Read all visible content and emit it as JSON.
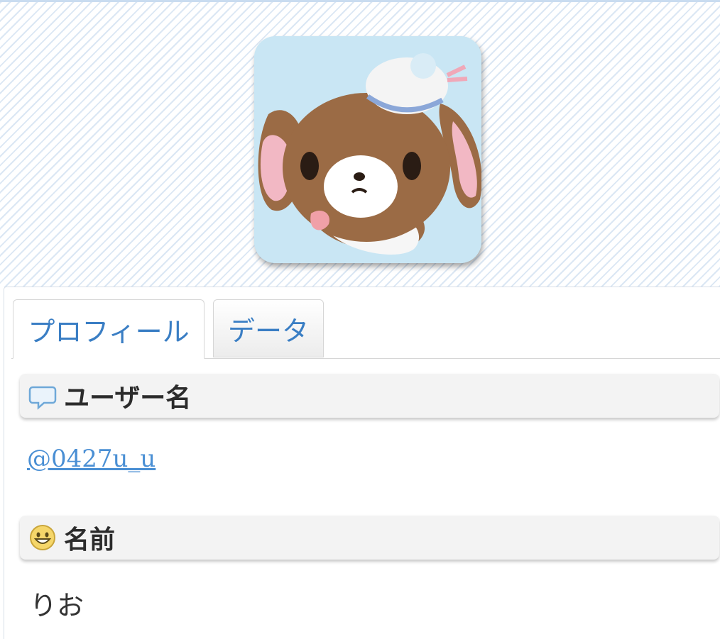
{
  "profile": {
    "avatar_alt": "avatar"
  },
  "tabs": [
    {
      "label": "プロフィール",
      "active": true
    },
    {
      "label": "データ",
      "active": false
    }
  ],
  "sections": {
    "username": {
      "heading": "ユーザー名",
      "icon": "speech-bubble-icon",
      "value": "@0427u_u"
    },
    "name": {
      "heading": "名前",
      "icon": "smiley-face-icon",
      "value": "りお"
    }
  },
  "colors": {
    "accent_link": "#4a8fd4",
    "tab_text": "#3a7ec4",
    "header_stripe": "#dbe7f4"
  }
}
